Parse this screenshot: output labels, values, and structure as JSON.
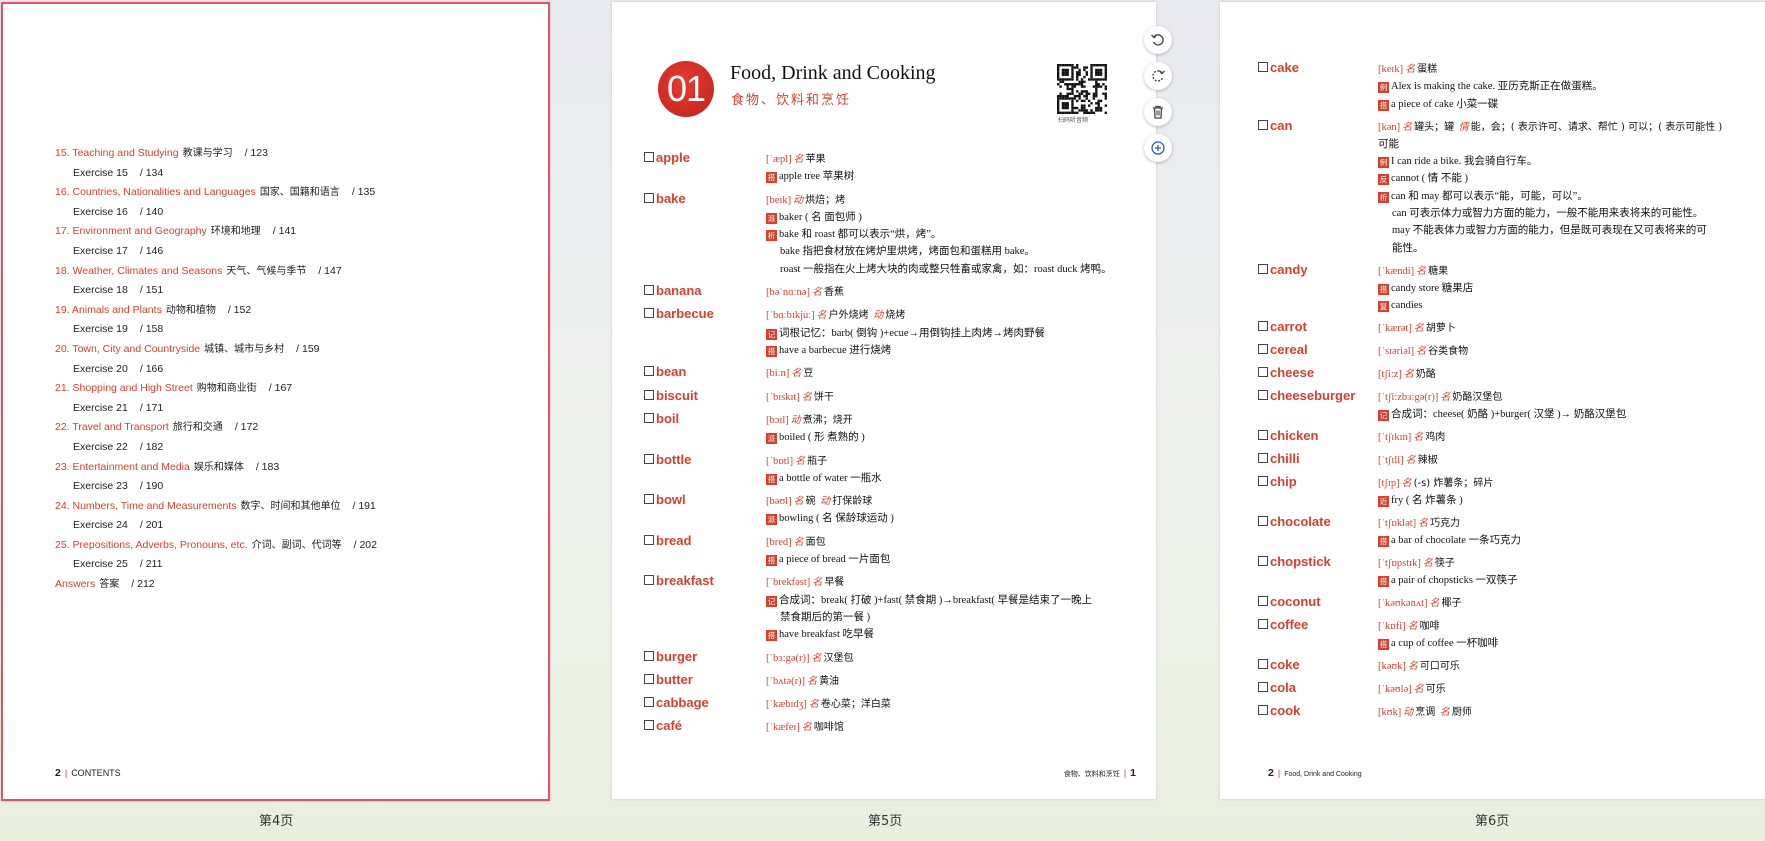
{
  "pages": [
    {
      "label": "第4页"
    },
    {
      "label": "第5页"
    },
    {
      "label": "第6页"
    }
  ],
  "toc": [
    {
      "kind": "chapter",
      "en": "15. Teaching and Studying",
      "cn": "教课与学习",
      "page": "/ 123"
    },
    {
      "kind": "exercise",
      "en": "Exercise 15",
      "page": "/ 134"
    },
    {
      "kind": "chapter",
      "en": "16. Countries, Nationalities and Languages",
      "cn": "国家、国籍和语言",
      "page": "/ 135"
    },
    {
      "kind": "exercise",
      "en": "Exercise 16",
      "page": "/ 140"
    },
    {
      "kind": "chapter",
      "en": "17. Environment and Geography",
      "cn": "环境和地理",
      "page": "/ 141"
    },
    {
      "kind": "exercise",
      "en": "Exercise 17",
      "page": "/ 146"
    },
    {
      "kind": "chapter",
      "en": "18. Weather, Climates and Seasons",
      "cn": "天气、气候与季节",
      "page": "/ 147"
    },
    {
      "kind": "exercise",
      "en": "Exercise 18",
      "page": "/ 151"
    },
    {
      "kind": "chapter",
      "en": "19. Animals and Plants",
      "cn": "动物和植物",
      "page": "/ 152"
    },
    {
      "kind": "exercise",
      "en": "Exercise 19",
      "page": "/ 158"
    },
    {
      "kind": "chapter",
      "en": "20. Town, City and Countryside",
      "cn": "城镇、城市与乡村",
      "page": "/ 159"
    },
    {
      "kind": "exercise",
      "en": "Exercise 20",
      "page": "/ 166"
    },
    {
      "kind": "chapter",
      "en": "21. Shopping and High Street",
      "cn": "购物和商业街",
      "page": "/ 167"
    },
    {
      "kind": "exercise",
      "en": "Exercise 21",
      "page": "/ 171"
    },
    {
      "kind": "chapter",
      "en": "22. Travel and Transport",
      "cn": "旅行和交通",
      "page": "/ 172"
    },
    {
      "kind": "exercise",
      "en": "Exercise 22",
      "page": "/ 182"
    },
    {
      "kind": "chapter",
      "en": "23. Entertainment and Media",
      "cn": "娱乐和媒体",
      "page": "/ 183"
    },
    {
      "kind": "exercise",
      "en": "Exercise 23",
      "page": "/ 190"
    },
    {
      "kind": "chapter",
      "en": "24. Numbers, Time and Measurements",
      "cn": "数字、时间和其他单位",
      "page": "/ 191"
    },
    {
      "kind": "exercise",
      "en": "Exercise 24",
      "page": "/ 201"
    },
    {
      "kind": "chapter",
      "en": "25. Prepositions, Adverbs, Pronouns, etc.",
      "cn": "介词、副词、代词等",
      "page": "/ 202"
    },
    {
      "kind": "exercise",
      "en": "Exercise 25",
      "page": "/ 211"
    },
    {
      "kind": "answers",
      "en": "Answers",
      "cn": "答案",
      "page": "/ 212"
    }
  ],
  "footer4": {
    "num": "2",
    "label": "CONTENTS"
  },
  "chapter": {
    "number": "01",
    "title": "Food, Drink and Cooking",
    "subtitle": "食物、饮料和烹饪",
    "qr_caption": "扫码听音频"
  },
  "footer5": {
    "label": "食物、饮料和烹饪",
    "num": "1"
  },
  "footer6": {
    "num": "2",
    "label": "Food, Drink and Cooking"
  },
  "toolbar": [
    {
      "icon": "rotate-left-icon",
      "name": "rotate-left-button"
    },
    {
      "icon": "rotate-right-icon",
      "name": "rotate-right-button"
    },
    {
      "icon": "trash-icon",
      "name": "delete-button"
    },
    {
      "icon": "plus-circle-icon",
      "name": "add-button"
    }
  ],
  "entries5": [
    {
      "word": "apple",
      "lines": [
        {
          "phon": "[ˈæpl]",
          "pos": "名",
          "zh": "苹果"
        },
        {
          "tag": "搭",
          "text": "apple tree 苹果树"
        }
      ]
    },
    {
      "word": "bake",
      "lines": [
        {
          "phon": "[beɪk]",
          "pos": "动",
          "zh": "烘焙；烤"
        },
        {
          "tag": "派",
          "text": "baker ( 名 面包师 )"
        },
        {
          "tag": "析",
          "text": "bake 和 roast 都可以表示“烘，烤”。"
        },
        {
          "indent": true,
          "text": "bake 指把食材放在烤炉里烘烤，烤面包和蛋糕用 bake。"
        },
        {
          "indent": true,
          "text": "roast 一般指在火上烤大块的肉或整只牲畜或家禽，如：roast duck 烤鸭。"
        }
      ]
    },
    {
      "word": "banana",
      "lines": [
        {
          "phon": "[bəˈnɑːnə]",
          "pos": "名",
          "zh": "香蕉"
        }
      ]
    },
    {
      "word": "barbecue",
      "lines": [
        {
          "phon": "[ˈbɑːbɪkjuː]",
          "pos": "名",
          "zh": "户外烧烤",
          "pos2": "动",
          "zh2": "烧烤"
        },
        {
          "tag": "记",
          "text": "词根记忆：barb( 倒钩 )+ecue→用倒钩挂上肉烤→烤肉野餐"
        },
        {
          "tag": "搭",
          "text": "have a barbecue 进行烧烤"
        }
      ]
    },
    {
      "word": "bean",
      "lines": [
        {
          "phon": "[biːn]",
          "pos": "名",
          "zh": "豆"
        }
      ]
    },
    {
      "word": "biscuit",
      "lines": [
        {
          "phon": "[ˈbɪskɪt]",
          "pos": "名",
          "zh": "饼干"
        }
      ]
    },
    {
      "word": "boil",
      "lines": [
        {
          "phon": "[bɔɪl]",
          "pos": "动",
          "zh": "煮沸；烧开"
        },
        {
          "tag": "派",
          "text": "boiled ( 形 煮熟的 )"
        }
      ]
    },
    {
      "word": "bottle",
      "lines": [
        {
          "phon": "[ˈbɒtl]",
          "pos": "名",
          "zh": "瓶子"
        },
        {
          "tag": "搭",
          "text": "a bottle of water 一瓶水"
        }
      ]
    },
    {
      "word": "bowl",
      "lines": [
        {
          "phon": "[bəʊl]",
          "pos": "名",
          "zh": "碗",
          "pos2": "动",
          "zh2": "打保龄球"
        },
        {
          "tag": "派",
          "text": "bowling ( 名 保龄球运动 )"
        }
      ]
    },
    {
      "word": "bread",
      "lines": [
        {
          "phon": "[bred]",
          "pos": "名",
          "zh": "面包"
        },
        {
          "tag": "搭",
          "text": "a piece of bread 一片面包"
        }
      ]
    },
    {
      "word": "breakfast",
      "lines": [
        {
          "phon": "[ˈbrekfəst]",
          "pos": "名",
          "zh": "早餐"
        },
        {
          "tag": "记",
          "text": "合成词：break( 打破 )+fast( 禁食期 )→breakfast( 早餐是结束了一晚上"
        },
        {
          "indent": true,
          "text": "禁食期后的第一餐 )"
        },
        {
          "tag": "搭",
          "text": "have breakfast 吃早餐"
        }
      ]
    },
    {
      "word": "burger",
      "lines": [
        {
          "phon": "[ˈbɜːgə(r)]",
          "pos": "名",
          "zh": "汉堡包"
        }
      ]
    },
    {
      "word": "butter",
      "lines": [
        {
          "phon": "[ˈbʌtə(r)]",
          "pos": "名",
          "zh": "黄油"
        }
      ]
    },
    {
      "word": "cabbage",
      "lines": [
        {
          "phon": "[ˈkæbɪdʒ]",
          "pos": "名",
          "zh": "卷心菜；洋白菜"
        }
      ]
    },
    {
      "word": "café",
      "lines": [
        {
          "phon": "[ˈkæfeɪ]",
          "pos": "名",
          "zh": "咖啡馆"
        }
      ]
    }
  ],
  "entries6": [
    {
      "word": "cake",
      "lines": [
        {
          "phon": "[keɪk]",
          "pos": "名",
          "zh": "蛋糕"
        },
        {
          "tag": "例",
          "text": "Alex is making the cake. 亚历克斯正在做蛋糕。"
        },
        {
          "tag": "搭",
          "text": "a piece of cake 小菜一碟"
        }
      ]
    },
    {
      "word": "can",
      "lines": [
        {
          "phon": "[kən]",
          "pos": "名",
          "zh": "罐头；罐",
          "pos2": "情",
          "zh2": "能，会；( 表示许可、请求、帮忙 ) 可以；( 表示可能性 )"
        },
        {
          "text": "可能"
        },
        {
          "tag": "例",
          "text": "I can ride a bike. 我会骑自行车。"
        },
        {
          "tag": "反",
          "text": "cannot ( 情 不能 )"
        },
        {
          "tag": "析",
          "text": "can 和 may 都可以表示“能，可能，可以”。"
        },
        {
          "indent": true,
          "text": "can 可表示体力或智力方面的能力，一般不能用来表将来的可能性。"
        },
        {
          "indent": true,
          "text": "may 不能表体力或智力方面的能力，但是既可表现在又可表将来的可"
        },
        {
          "indent": true,
          "text": "能性。"
        }
      ]
    },
    {
      "word": "candy",
      "lines": [
        {
          "phon": "[ˈkændi]",
          "pos": "名",
          "zh": "糖果"
        },
        {
          "tag": "搭",
          "text": "candy store 糖果店"
        },
        {
          "tag": "复",
          "text": "candies"
        }
      ]
    },
    {
      "word": "carrot",
      "lines": [
        {
          "phon": "[ˈkærət]",
          "pos": "名",
          "zh": "胡萝卜"
        }
      ]
    },
    {
      "word": "cereal",
      "lines": [
        {
          "phon": "[ˈsɪəriəl]",
          "pos": "名",
          "zh": "谷类食物"
        }
      ]
    },
    {
      "word": "cheese",
      "lines": [
        {
          "phon": "[tʃiːz]",
          "pos": "名",
          "zh": "奶酪"
        }
      ]
    },
    {
      "word": "cheeseburger",
      "lines": [
        {
          "phon": "[ˈtʃiːzbɜːgə(r)]",
          "pos": "名",
          "zh": "奶酪汉堡包"
        },
        {
          "tag": "记",
          "text": "合成词：cheese( 奶酪 )+burger( 汉堡 )→ 奶酪汉堡包"
        }
      ]
    },
    {
      "word": "chicken",
      "lines": [
        {
          "phon": "[ˈtʃɪkɪn]",
          "pos": "名",
          "zh": "鸡肉"
        }
      ]
    },
    {
      "word": "chilli",
      "lines": [
        {
          "phon": "[ˈtʃɪli]",
          "pos": "名",
          "zh": "辣椒"
        }
      ]
    },
    {
      "word": "chip",
      "lines": [
        {
          "phon": "[tʃɪp]",
          "pos": "名",
          "zh": "(-s) 炸薯条；碎片"
        },
        {
          "tag": "近",
          "text": "fry ( 名 炸薯条 )"
        }
      ]
    },
    {
      "word": "chocolate",
      "lines": [
        {
          "phon": "[ˈtʃɒklət]",
          "pos": "名",
          "zh": "巧克力"
        },
        {
          "tag": "搭",
          "text": "a bar of chocolate 一条巧克力"
        }
      ]
    },
    {
      "word": "chopstick",
      "lines": [
        {
          "phon": "[ˈtʃɒpstɪk]",
          "pos": "名",
          "zh": "筷子"
        },
        {
          "tag": "搭",
          "text": "a pair of chopsticks 一双筷子"
        }
      ]
    },
    {
      "word": "coconut",
      "lines": [
        {
          "phon": "[ˈkəʊkənʌt]",
          "pos": "名",
          "zh": "椰子"
        }
      ]
    },
    {
      "word": "coffee",
      "lines": [
        {
          "phon": "[ˈkɒfi]",
          "pos": "名",
          "zh": "咖啡"
        },
        {
          "tag": "搭",
          "text": "a cup of coffee 一杯咖啡"
        }
      ]
    },
    {
      "word": "coke",
      "lines": [
        {
          "phon": "[kəʊk]",
          "pos": "名",
          "zh": "可口可乐"
        }
      ]
    },
    {
      "word": "cola",
      "lines": [
        {
          "phon": "[ˈkəʊlə]",
          "pos": "名",
          "zh": "可乐"
        }
      ]
    },
    {
      "word": "cook",
      "lines": [
        {
          "phon": "[kʊk]",
          "pos": "动",
          "zh": "烹调",
          "pos2": "名",
          "zh2": "厨师"
        }
      ]
    }
  ]
}
